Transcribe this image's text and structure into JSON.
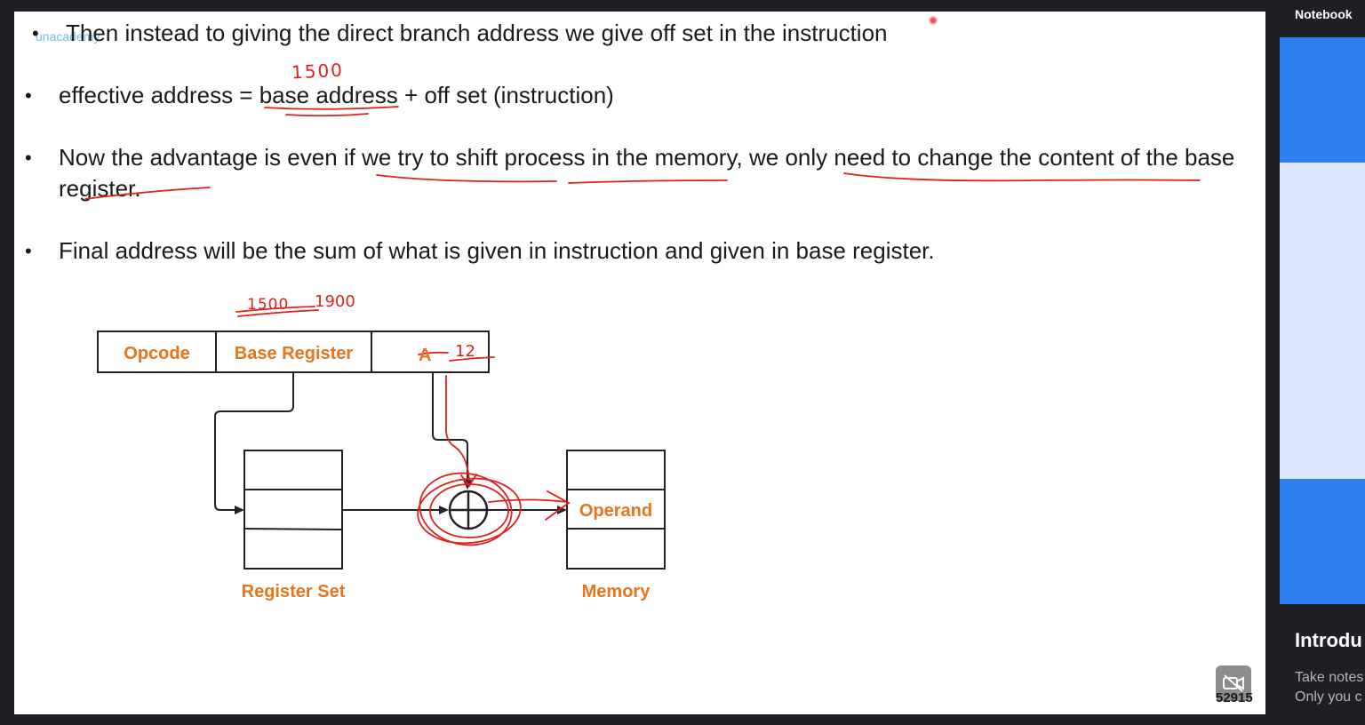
{
  "slide": {
    "watermark": "unacademy",
    "bullets": [
      "Then instead to giving the direct branch address we give off set in the instruction",
      "effective address = base address + off set (instruction)",
      "Now the advantage is even if we try to shift process in the memory, we only need to change the content of the base register.",
      "Final address will be the sum of what is given in instruction and given in base register."
    ],
    "bullet_symbol": "•",
    "diagram": {
      "instruction_fields": [
        "Opcode",
        "Base Register",
        "A"
      ],
      "register_set_label": "Register Set",
      "memory_label": "Memory",
      "operand_label": "Operand"
    },
    "annotations": {
      "base_value": "1500",
      "struck_value": "1500",
      "new_value": "1900",
      "offset_value": "12"
    },
    "accent_color": "#e8741b",
    "ink_color": "#e0201b"
  },
  "player": {
    "counter": "52915",
    "camera_icon": "camera-off-icon"
  },
  "notebook": {
    "title": "Notebook",
    "section_title": "Introdu",
    "hint_line1": "Take notes",
    "hint_line2": "Only you c"
  }
}
